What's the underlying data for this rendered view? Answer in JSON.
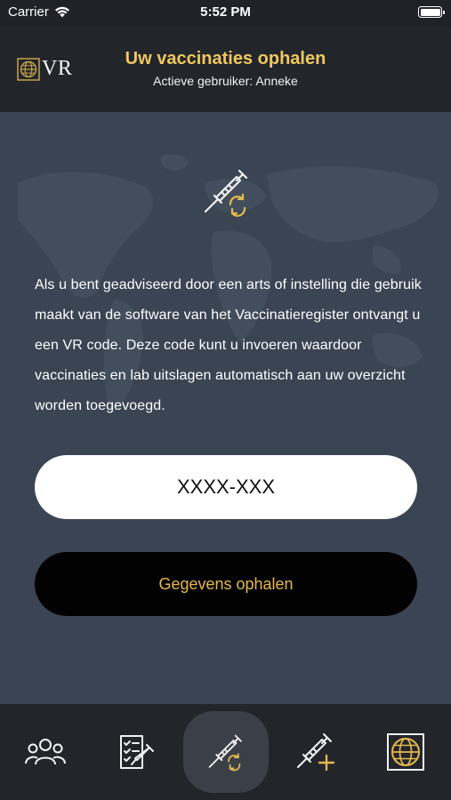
{
  "status_bar": {
    "carrier": "Carrier",
    "time": "5:52 PM",
    "icons": [
      "wifi-icon",
      "battery-icon"
    ]
  },
  "header": {
    "logo_text": "VR",
    "logo_icon": "globe-icon",
    "title": "Uw vaccinaties ophalen",
    "subtitle": "Actieve gebruiker: Anneke"
  },
  "main": {
    "hero_icon": "syringe-sync-icon",
    "description": "Als u bent geadviseerd door een arts of instelling die gebruik maakt van de software van het Vaccinatieregister ontvangt u een VR code. Deze code kunt u invoeren waardoor vaccinaties en lab uitslagen automatisch aan uw overzicht worden toegevoegd.",
    "code_input": {
      "value": "",
      "placeholder": "XXXX-XXX"
    },
    "fetch_button_label": "Gegevens ophalen"
  },
  "tab_bar": {
    "tabs": [
      {
        "icon": "users-icon",
        "active": false
      },
      {
        "icon": "checklist-syringe-icon",
        "active": false
      },
      {
        "icon": "syringe-sync-icon",
        "active": true
      },
      {
        "icon": "syringe-add-icon",
        "active": false
      },
      {
        "icon": "globe-icon",
        "active": false
      }
    ]
  },
  "colors": {
    "accent": "#f0c75e",
    "header_bg": "#22262b",
    "main_bg": "#3a4452",
    "button_bg": "#020202",
    "button_text": "#e4b84f"
  }
}
